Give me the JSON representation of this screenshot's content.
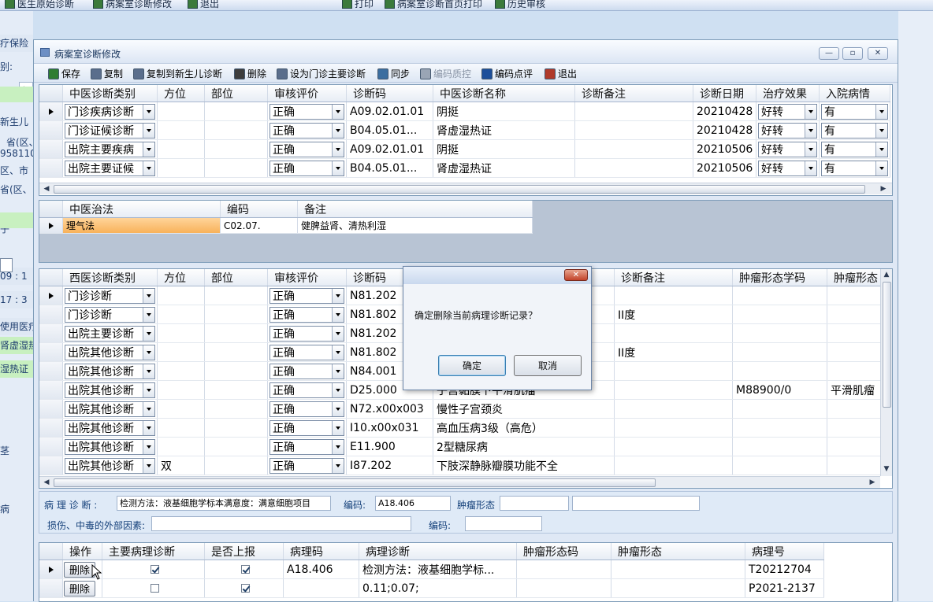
{
  "topbar": [
    "医生原始诊断",
    "病案室诊断修改",
    "退出",
    "打印",
    "病案室诊断首页打印",
    "历史审核"
  ],
  "bg_left": [
    "疗保险",
    "别:",
    "女",
    "新生儿",
    "省(区、",
    "958110",
    "区、市",
    "省(区、",
    "子",
    "09 : 1",
    "17 : 3",
    "使用医疗",
    "肾虚湿热",
    "湿热证",
    "茎",
    "病"
  ],
  "window": {
    "title": "病案室诊断修改",
    "buttons": {
      "minimize": "—",
      "restore": "▫",
      "close": "✕"
    }
  },
  "toolbar": [
    {
      "name": "save",
      "label": "保存",
      "color": "#2f7d32",
      "disabled": false
    },
    {
      "name": "copy",
      "label": "复制",
      "color": "#5a6e8c",
      "disabled": false
    },
    {
      "name": "copy-newborn",
      "label": "复制到新生儿诊断",
      "color": "#5a6e8c",
      "disabled": false
    },
    {
      "name": "delete",
      "label": "删除",
      "color": "#3d3d3d",
      "disabled": false
    },
    {
      "name": "set-main",
      "label": "设为门诊主要诊断",
      "color": "#5a6e8c",
      "disabled": false
    },
    {
      "name": "sync",
      "label": "同步",
      "color": "#3b6ea0",
      "disabled": false
    },
    {
      "name": "quality",
      "label": "编码质控",
      "color": "#9aa5b5",
      "disabled": true
    },
    {
      "name": "review",
      "label": "编码点评",
      "color": "#1d4f9a",
      "disabled": false
    },
    {
      "name": "exit",
      "label": "退出",
      "color": "#b03a2a",
      "disabled": false
    }
  ],
  "tcm_grid": {
    "headers": [
      "中医诊断类别",
      "方位",
      "部位",
      "审核评价",
      "诊断码",
      "中医诊断名称",
      "诊断备注",
      "诊断日期",
      "治疗效果",
      "入院病情"
    ],
    "rows": [
      [
        "门诊疾病诊断",
        "",
        "",
        "正确",
        "A09.02.01.01",
        "阴挺",
        "",
        "20210428",
        "好转",
        "有"
      ],
      [
        "门诊证候诊断",
        "",
        "",
        "正确",
        "B04.05.01...",
        "肾虚湿热证",
        "",
        "20210428",
        "好转",
        "有"
      ],
      [
        "出院主要疾病",
        "",
        "",
        "正确",
        "A09.02.01.01",
        "阴挺",
        "",
        "20210506",
        "好转",
        "有"
      ],
      [
        "出院主要证候",
        "",
        "",
        "正确",
        "B04.05.01...",
        "肾虚湿热证",
        "",
        "20210506",
        "好转",
        "有"
      ]
    ]
  },
  "treatment_grid": {
    "headers": [
      "中医治法",
      "编码",
      "备注"
    ],
    "rows": [
      [
        "理气法",
        "C02.07.",
        "健脾益肾、清热利湿"
      ]
    ]
  },
  "wm_grid": {
    "headers": [
      "西医诊断类别",
      "方位",
      "部位",
      "审核评价",
      "诊断码",
      "",
      "诊断备注",
      "肿瘤形态学码",
      "肿瘤形态"
    ],
    "rows": [
      [
        "门诊诊断",
        "",
        "",
        "正确",
        "N81.202",
        "",
        "",
        "",
        ""
      ],
      [
        "门诊诊断",
        "",
        "",
        "正确",
        "N81.802",
        "",
        "II度",
        "",
        ""
      ],
      [
        "出院主要诊断",
        "",
        "",
        "正确",
        "N81.202",
        "",
        "",
        "",
        ""
      ],
      [
        "出院其他诊断",
        "",
        "",
        "正确",
        "N81.802",
        "",
        "II度",
        "",
        ""
      ],
      [
        "出院其他诊断",
        "",
        "",
        "正确",
        "N84.001",
        "",
        "",
        "",
        ""
      ],
      [
        "出院其他诊断",
        "",
        "",
        "正确",
        "D25.000",
        "子宫黏膜下平滑肌瘤",
        "",
        "M88900/0",
        "平滑肌瘤"
      ],
      [
        "出院其他诊断",
        "",
        "",
        "正确",
        "N72.x00x003",
        "慢性子宫颈炎",
        "",
        "",
        ""
      ],
      [
        "出院其他诊断",
        "",
        "",
        "正确",
        "I10.x00x031",
        "高血压病3级（高危）",
        "",
        "",
        ""
      ],
      [
        "出院其他诊断",
        "",
        "",
        "正确",
        "E11.900",
        "2型糖尿病",
        "",
        "",
        ""
      ],
      [
        "出院其他诊断",
        "双",
        "",
        "正确",
        "I87.202",
        "下肢深静脉瓣膜功能不全",
        "",
        "",
        ""
      ]
    ]
  },
  "pathology_form": {
    "label_diag": "病 理 诊 断 :",
    "diag_value": "检测方法：液基细胞学标本满意度：满意细胞项目",
    "label_code": "编码:",
    "code_value": "A18.406",
    "label_tumor": "肿瘤形态",
    "tumor_value": "",
    "tumor_value2": "",
    "label_injury": "损伤、中毒的外部因素:",
    "injury_value": "",
    "label_code2": "编码:",
    "code2_value": ""
  },
  "path_grid": {
    "headers": [
      "操作",
      "主要病理诊断",
      "是否上报",
      "病理码",
      "病理诊断",
      "肿瘤形态码",
      "肿瘤形态",
      "病理号"
    ],
    "rows": [
      {
        "action": "删除",
        "main": true,
        "report": true,
        "code": "A18.406",
        "diag": "检测方法：液基细胞学标...",
        "tcode": "",
        "tform": "",
        "no": "T20212704"
      },
      {
        "action": "删除",
        "main": false,
        "report": true,
        "code": "",
        "diag": "0.11;0.07;",
        "tcode": "",
        "tform": "",
        "no": "P2021-2137"
      }
    ]
  },
  "dialog": {
    "message": "确定删除当前病理诊断记录？",
    "ok": "确定",
    "cancel": "取消",
    "close": "✕"
  }
}
